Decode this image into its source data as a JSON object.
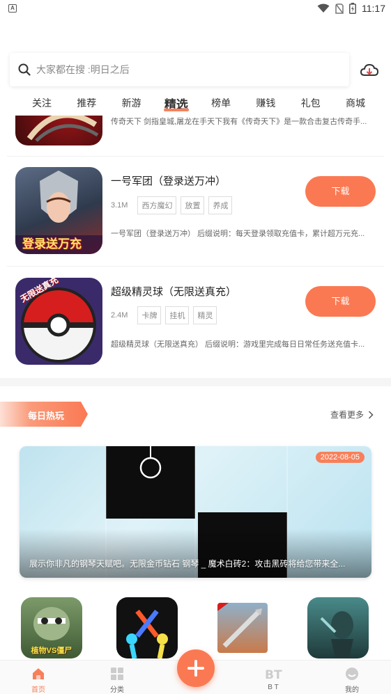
{
  "status_bar": {
    "time": "11:17"
  },
  "search": {
    "placeholder": "大家都在搜 :明日之后"
  },
  "tabs": [
    {
      "label": "关注"
    },
    {
      "label": "推荐"
    },
    {
      "label": "新游"
    },
    {
      "label": "精选"
    },
    {
      "label": "榜单"
    },
    {
      "label": "赚钱"
    },
    {
      "label": "礼包"
    },
    {
      "label": "商城"
    }
  ],
  "active_tab": "精选",
  "list": {
    "partial_item": {
      "desc": "传奇天下 剑指皇城,屠龙在手天下我有《传奇天下》是一款合击复古传奇手..."
    },
    "items": [
      {
        "title": "一号军团（登录送万冲）",
        "size": "3.1M",
        "tags": [
          "西方魔幻",
          "放置",
          "养成"
        ],
        "desc": "一号军团（登录送万冲） 后缀说明：每天登录领取充值卡，累计超万元充...",
        "button": "下载",
        "icon_text": "登录送万充"
      },
      {
        "title": "超级精灵球（无限送真充）",
        "size": "2.4M",
        "tags": [
          "卡牌",
          "挂机",
          "精灵"
        ],
        "desc": "超级精灵球（无限送真充） 后缀说明：游戏里完成每日日常任务送充值卡...",
        "button": "下载",
        "icon_text": "无限送真充"
      }
    ]
  },
  "daily": {
    "label": "每日热玩",
    "see_more": "查看更多",
    "banner": {
      "date": "2022-08-05",
      "caption": "展示你非凡的钢琴天赋吧。无限金币钻石 钢琴 _ 魔术白砖2：攻击黑砖将给您带来全..."
    },
    "mini_icons": [
      "zombie-game-icon",
      "stickman-game-icon",
      "rocket-game-icon",
      "warrior-game-icon"
    ],
    "mini_icon_text": "植物VS僵尸"
  },
  "bottom_nav": [
    {
      "label": "首页",
      "active": true
    },
    {
      "label": "分类",
      "active": false
    },
    {
      "label": "B T",
      "active": false
    },
    {
      "label": "我的",
      "active": false
    }
  ],
  "colors": {
    "accent": "#fa7953"
  }
}
